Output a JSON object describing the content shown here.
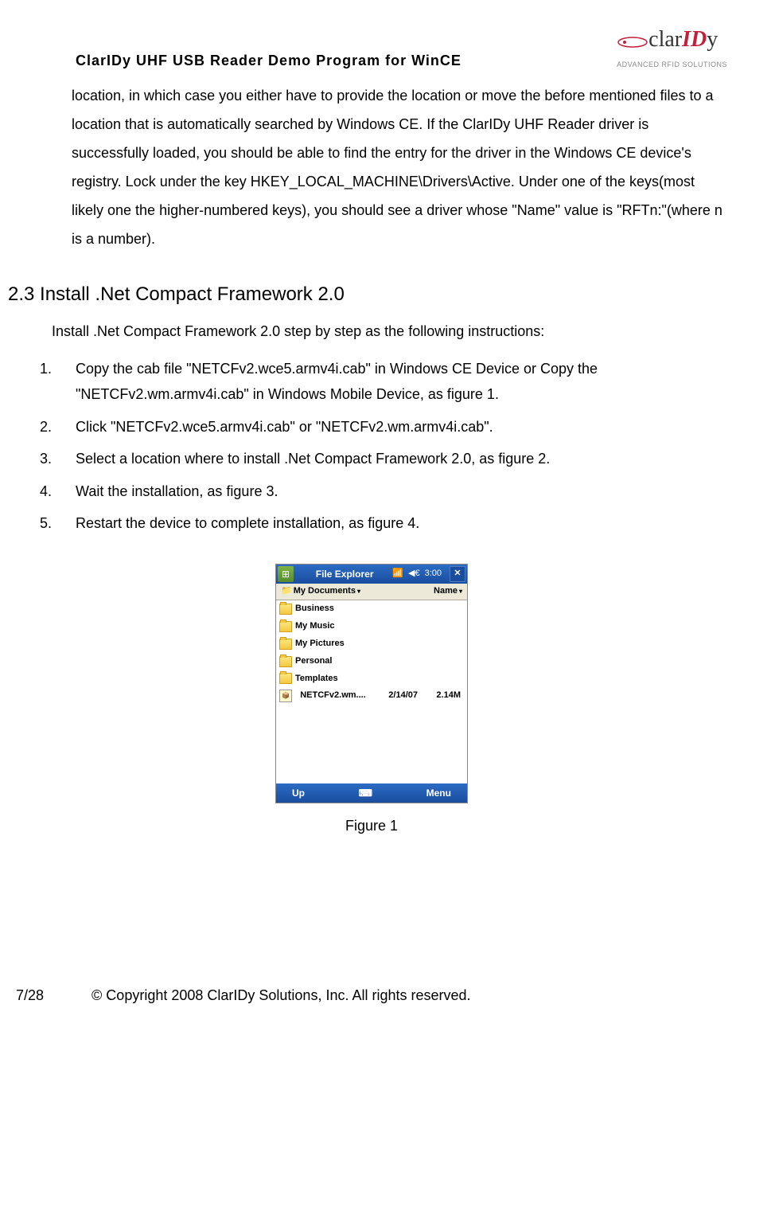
{
  "header": {
    "title": "ClarIDy UHF USB Reader Demo Program for WinCE",
    "logo": {
      "part1": "clar",
      "part2": "ID",
      "part3": "y",
      "subtitle": "ADVANCED RFID SOLUTIONS"
    }
  },
  "body_paragraph": "location, in which case you either have to provide the location or move the before mentioned files to a location that is automatically searched by Windows CE. If the ClarIDy UHF Reader driver is successfully loaded, you should be able to find the entry for the driver in the Windows CE device's registry. Lock under the key HKEY_LOCAL_MACHINE\\Drivers\\Active. Under one of the keys(most likely one the higher-numbered keys), you should see a driver whose \"Name\" value is \"RFTn:\"(where n is a number).",
  "section": {
    "heading": "2.3 Install .Net Compact Framework 2.0",
    "intro": "Install .Net Compact Framework 2.0 step by step as the following instructions:",
    "items": [
      {
        "num": "1.",
        "text": "Copy the cab file \"NETCFv2.wce5.armv4i.cab\" in Windows CE Device or Copy the \"NETCFv2.wm.armv4i.cab\" in Windows Mobile Device, as figure 1."
      },
      {
        "num": "2.",
        "text": "Click \"NETCFv2.wce5.armv4i.cab\" or \"NETCFv2.wm.armv4i.cab\"."
      },
      {
        "num": "3.",
        "text": "Select a location where to install .Net Compact Framework 2.0, as figure 2."
      },
      {
        "num": "4.",
        "text": "Wait the installation, as figure 3."
      },
      {
        "num": "5.",
        "text": "Restart the device to complete installation, as figure 4."
      }
    ]
  },
  "figure": {
    "caption": "Figure 1",
    "titlebar": {
      "title": "File Explorer",
      "time": "3:00"
    },
    "toolbar": {
      "location": "My Documents",
      "sort": "Name"
    },
    "files": [
      {
        "type": "folder",
        "name": "Business"
      },
      {
        "type": "folder",
        "name": "My Music"
      },
      {
        "type": "folder",
        "name": "My Pictures"
      },
      {
        "type": "folder",
        "name": "Personal"
      },
      {
        "type": "folder",
        "name": "Templates"
      },
      {
        "type": "cab",
        "name": "NETCFv2.wm....",
        "date": "2/14/07",
        "size": "2.14M"
      }
    ],
    "bottombar": {
      "left": "Up",
      "right": "Menu"
    }
  },
  "footer": {
    "page": "7/28",
    "copyright": "© Copyright 2008 ClarIDy Solutions, Inc. All rights reserved."
  }
}
